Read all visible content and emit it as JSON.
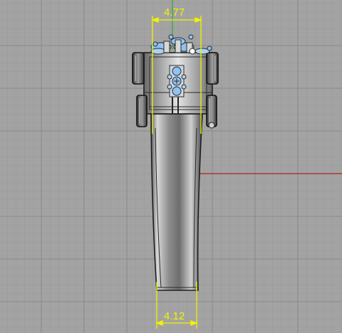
{
  "viewport": {
    "name": "front-view-viewport",
    "background": "#a3a3a3",
    "grid_minor_color": "#999999",
    "grid_major_color": "#8a8a8a",
    "x_axis_color": "#b32020",
    "y_axis_color": "#2da82d",
    "dimension_color": "#f2f200",
    "gem_color": "#8fc3f0"
  },
  "dimensions": {
    "top_width": "4.77",
    "bottom_width": "4.12"
  }
}
